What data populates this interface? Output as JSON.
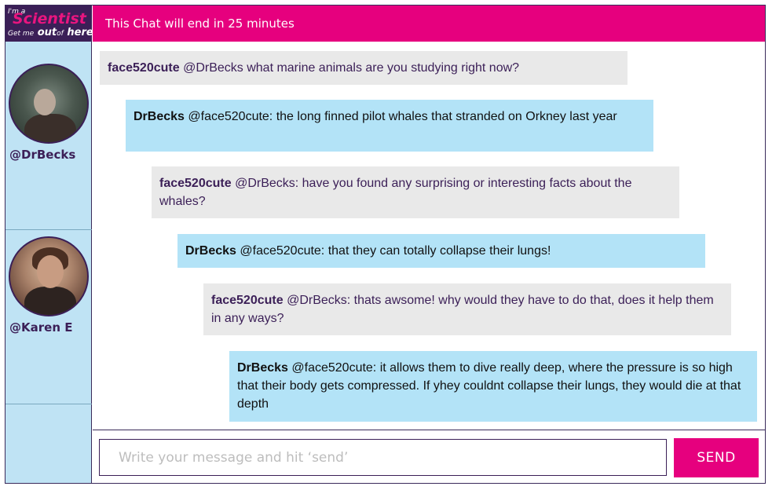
{
  "logo": {
    "line1": "I'm a",
    "line2": "Scientist",
    "line3a": "Get me",
    "line3b": "out",
    "line3c": "of",
    "line3d": "here"
  },
  "header": {
    "title": "This Chat will end in 25 minutes"
  },
  "participants": [
    {
      "handle": "@DrBecks"
    },
    {
      "handle": "@Karen E"
    }
  ],
  "messages": [
    {
      "author": "face520cute",
      "text": " @DrBecks what marine animals are you studying right now?"
    },
    {
      "author": "DrBecks",
      "text": " @face520cute: the long finned pilot whales that stranded on Orkney last year"
    },
    {
      "author": "face520cute",
      "text": " @DrBecks: have you found any surprising or interesting facts about the whales?"
    },
    {
      "author": "DrBecks",
      "text": " @face520cute: that they can totally collapse their lungs!"
    },
    {
      "author": "face520cute",
      "text": " @DrBecks: thats awsome! why would they have to do that, does it help them in any ways?"
    },
    {
      "author": "DrBecks",
      "text": " @face520cute: it allows them to dive really deep, where the pressure is so high that their body gets compressed. If yhey couldnt collapse their lungs, they would die at that depth"
    }
  ],
  "composer": {
    "placeholder": "Write your message and hit ‘send’",
    "value": "",
    "send_label": "SEND"
  },
  "colors": {
    "brand_pink": "#e6007e",
    "brand_purple": "#3b1f57",
    "sidebar_blue": "#bfe3f4",
    "scientist_bubble": "#b3e3f7",
    "student_bubble": "#e9e9e9"
  }
}
